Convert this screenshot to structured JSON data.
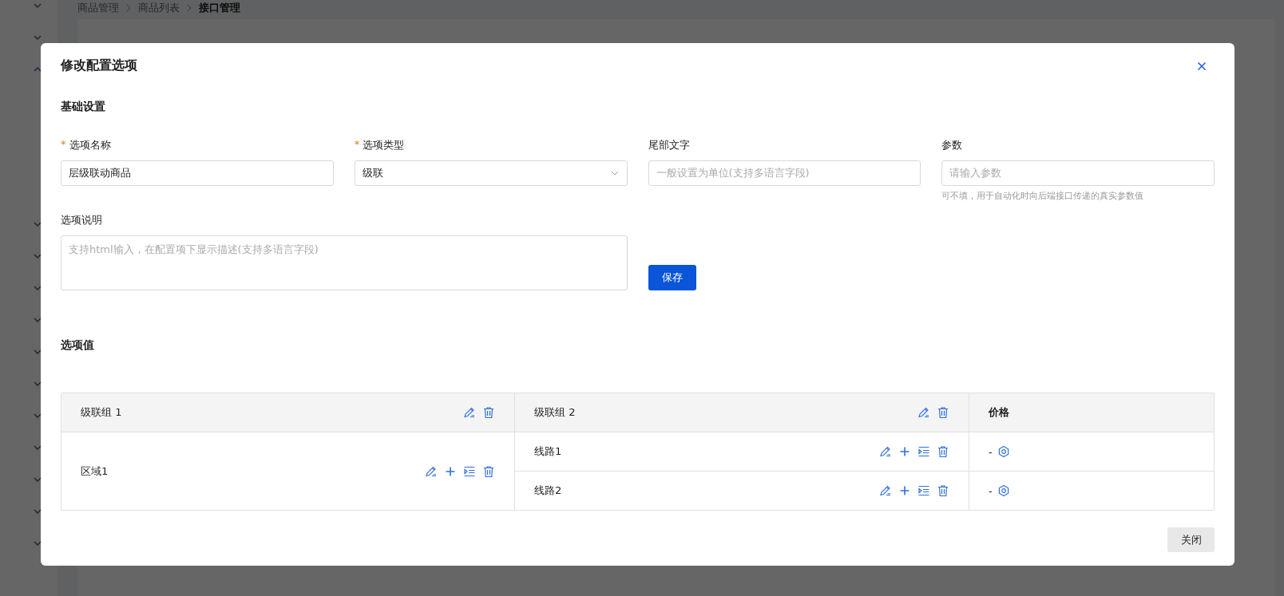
{
  "breadcrumb": [
    "商品管理",
    "商品列表",
    "接口管理"
  ],
  "dialog": {
    "title": "修改配置选项",
    "basic": {
      "title": "基础设置",
      "fields": [
        {
          "kind": "input",
          "label": "选项名称",
          "required_mark": "*",
          "value": "层级联动商品"
        },
        {
          "kind": "select",
          "label": "选项类型",
          "required_mark": "*",
          "value": "级联"
        },
        {
          "kind": "input",
          "label": "尾部文字",
          "placeholder": "一般设置为单位(支持多语言字段)"
        },
        {
          "kind": "input",
          "label": "参数",
          "placeholder": "请输入参数",
          "hint": "可不填，用于自动化时向后端接口传递的真实参数值"
        }
      ],
      "description": {
        "label": "选项说明",
        "placeholder": "支持html输入，在配置项下显示描述(支持多语言字段)"
      },
      "save": "保存"
    },
    "values": {
      "title": "选项值",
      "columns": [
        {
          "kind": "group",
          "title": "级联组 1"
        },
        {
          "kind": "group",
          "title": "级联组 2"
        },
        {
          "kind": "price",
          "title": "价格"
        }
      ],
      "rows": [
        {
          "label": "区域1",
          "children": [
            {
              "label": "线路1",
              "price": "-"
            },
            {
              "label": "线路2",
              "price": "-"
            }
          ]
        }
      ]
    },
    "close_button": "关闭"
  }
}
